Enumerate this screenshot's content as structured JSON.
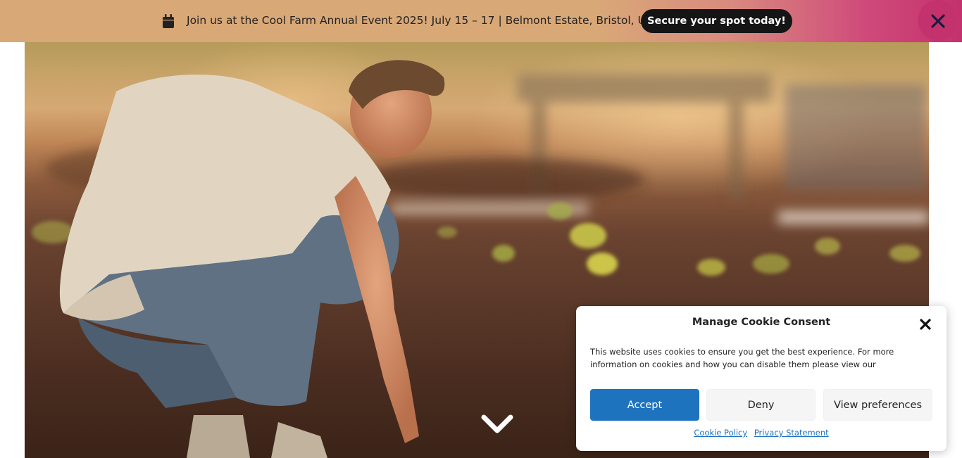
{
  "announcement": {
    "icon": "calendar-icon",
    "text": "Join us at the Cool Farm Annual Event 2025! July 15 – 17 | Belmont Estate, Bristol, UK",
    "cta_label": "Secure your spot today!",
    "close_icon": "close-icon",
    "colors": {
      "bar": "#d9a877",
      "gradient_end": "#c4326e",
      "cta_bg": "#151515"
    }
  },
  "hero": {
    "scroll_icon": "chevron-down-icon"
  },
  "cookie_consent": {
    "title": "Manage Cookie Consent",
    "message": "This website uses cookies to ensure you get the best experience. For more information on cookies and how you can disable them please view our",
    "accept_label": "Accept",
    "deny_label": "Deny",
    "preferences_label": "View preferences",
    "links": [
      {
        "label": "Cookie Policy"
      },
      {
        "label": "Privacy Statement"
      }
    ],
    "colors": {
      "accept": "#1e73be",
      "link": "#1e73be"
    }
  }
}
